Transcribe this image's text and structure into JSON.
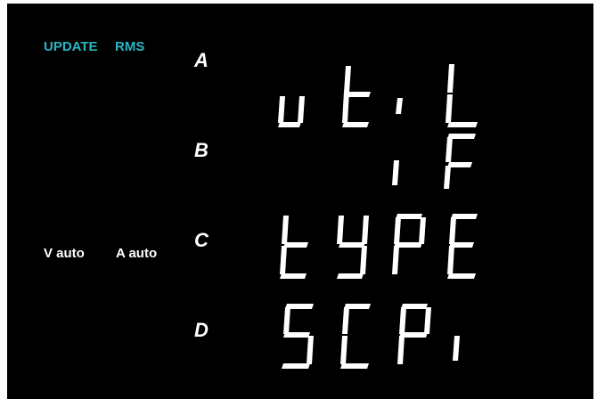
{
  "status": {
    "update": "UPDATE",
    "rms": "RMS",
    "v_range": "V auto",
    "a_range": "A auto"
  },
  "rows": [
    {
      "label": "A",
      "display": "util"
    },
    {
      "label": "B",
      "display": "if"
    },
    {
      "label": "C",
      "display": "tYPE"
    },
    {
      "label": "D",
      "display": "SCPi"
    }
  ],
  "colors": {
    "background": "#000000",
    "indicator": "#2bb5c4",
    "text": "#ffffff"
  }
}
